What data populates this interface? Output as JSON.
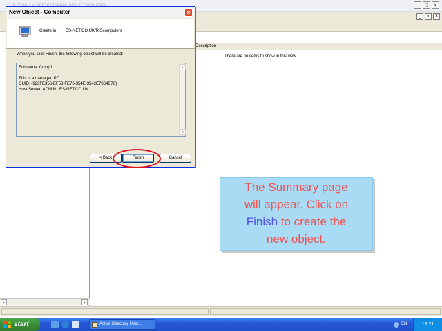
{
  "app": {
    "title": "Active Directory Users and Computers",
    "column_header": "Description",
    "empty_message": "There are no items to show in this view."
  },
  "dialog": {
    "title": "New Object - Computer",
    "create_in_label": "Create in:",
    "create_in_value": "ES-NET.CO.UK/RIScomputers",
    "intro": "When you click Finish, the following object will be created:",
    "summary": [
      "Full name: Comp1",
      "",
      "This is a managed PC.",
      "GUID: {923FE356-EF53-FE76-354E-3542E7864E76}",
      "Host Server: ADMIN1.ES-NET.CO.UK"
    ],
    "buttons": {
      "back": "< Back",
      "finish": "Finish",
      "cancel": "Cancel"
    },
    "close_glyph": "×"
  },
  "callout": {
    "line1": "The Summary page",
    "line2": "will appear. Click on",
    "line3_highlight": "Finish",
    "line3_rest": " to create the",
    "line4": "new object."
  },
  "taskbar": {
    "start_label": "start",
    "task_label": "Active Directory User...",
    "language": "EN",
    "clock": "13:21"
  },
  "colors": {
    "highlight_ring": "#e0111e",
    "callout_bg": "#a9dbf5",
    "callout_text": "#ef5250",
    "callout_accent": "#5050e0",
    "taskbar": "#2557d6",
    "start_button": "#3c8f3a"
  }
}
